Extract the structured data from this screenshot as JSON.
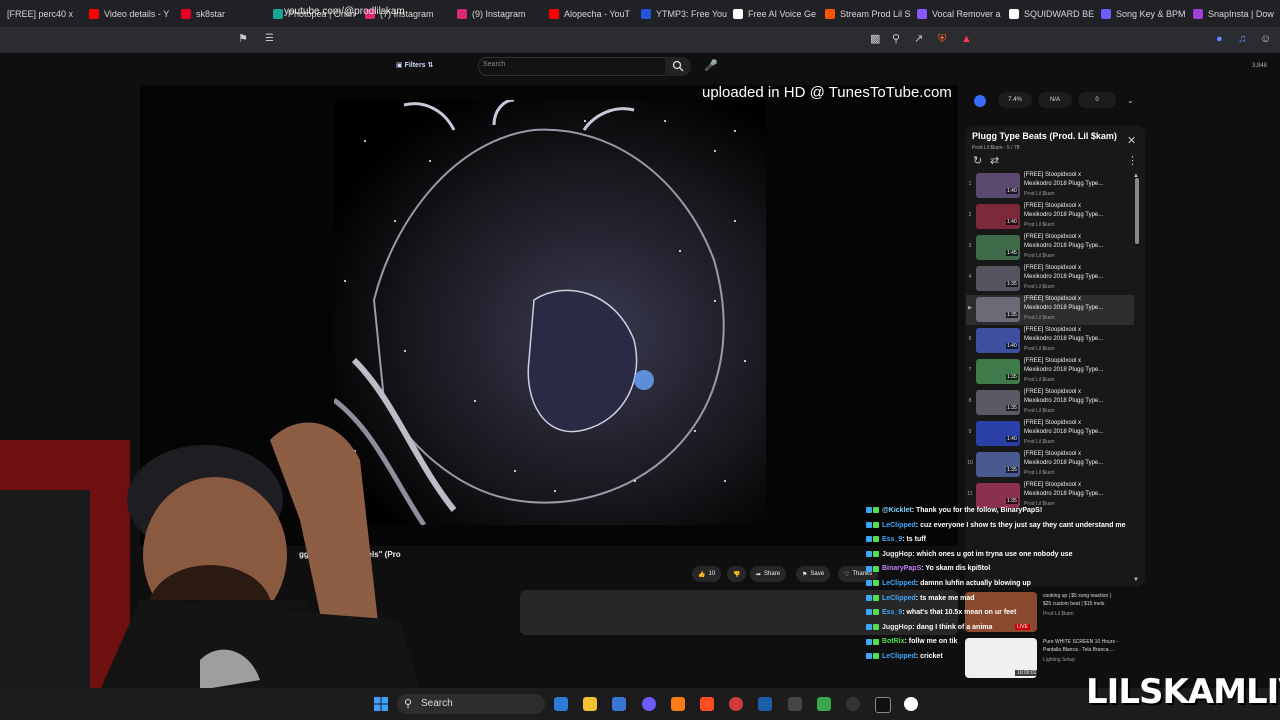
{
  "browser": {
    "tabs": [
      {
        "label": "[FREE] perc40 x",
        "color": "#e1e1e1"
      },
      {
        "label": "Video details - Y",
        "color": "#ff0000"
      },
      {
        "label": "sk8star",
        "color": "#e60023"
      },
      {
        "label": "Photopea | Onlin",
        "color": "#18a497"
      },
      {
        "label": "(7) Instagram",
        "color": "#d62976"
      },
      {
        "label": "(9) Instagram",
        "color": "#d62976"
      },
      {
        "label": "Alopecha - YouT",
        "color": "#ff0000"
      },
      {
        "label": "YTMP3: Free You",
        "color": "#2255dd"
      },
      {
        "label": "Free AI Voice Ge",
        "color": "#ffffff"
      },
      {
        "label": "Stream Prod Lil S",
        "color": "#ff5500"
      },
      {
        "label": "Vocal Remover a",
        "color": "#8855ff"
      },
      {
        "label": "SQUIDWARD BE",
        "color": "#ffffff"
      },
      {
        "label": "Song Key & BPM",
        "color": "#6a5cff"
      },
      {
        "label": "SnapInsta | Dow",
        "color": "#a23ed8"
      }
    ],
    "address": "youtube.com/@prodlilskam"
  },
  "youtube": {
    "filters_label": "Filters",
    "search_placeholder": "Search",
    "counter": "3,848",
    "watermark": "uploaded in HD @ TunesToTube.com",
    "video_title": "gg Type Beat \"jewels\" (Pro",
    "actions": {
      "like_count": "10",
      "share_label": "Share",
      "save_label": "Save",
      "thanks_label": "Thanks"
    },
    "stats": [
      "7.4%",
      "N/A",
      "0"
    ],
    "playlist": {
      "title": "Plugg Type Beats (Prod. Lil $kam)",
      "subtitle": "Prod Lil $kam - 5 / 78",
      "items": [
        {
          "num": "1",
          "t1": "[FREE] Stoopidxool x",
          "t2": "Mexikodro 2018 Plugg Type...",
          "channel": "Prod Lil $kam",
          "dur": "1:40",
          "color": "#5a4a70"
        },
        {
          "num": "2",
          "t1": "[FREE] Stoopidxool x",
          "t2": "Mexikodro 2018 Plugg Type...",
          "channel": "Prod Lil $kam",
          "dur": "1:40",
          "color": "#7a2a3a"
        },
        {
          "num": "3",
          "t1": "[FREE] Stoopidxool x",
          "t2": "Mexikodro 2018 Plugg Type...",
          "channel": "Prod Lil $kam",
          "dur": "1:45",
          "color": "#3f6a4a"
        },
        {
          "num": "4",
          "t1": "[FREE] Stoopidxool x",
          "t2": "Mexikodro 2018 Plugg Type...",
          "channel": "Prod Lil $kam",
          "dur": "1:35",
          "color": "#555560"
        },
        {
          "num": "",
          "t1": "[FREE] Stoopidxool x",
          "t2": "Mexikodro 2018 Plugg Type...",
          "channel": "Prod Lil $kam",
          "dur": "1:35",
          "color": "#6b6b78",
          "active": true
        },
        {
          "num": "6",
          "t1": "[FREE] Stoopidxool x",
          "t2": "Mexikodro 2018 Plugg Type...",
          "channel": "Prod Lil $kam",
          "dur": "1:40",
          "color": "#3f4fa0"
        },
        {
          "num": "7",
          "t1": "[FREE] Stoopidxool x",
          "t2": "Mexikodro 2018 Plugg Type...",
          "channel": "Prod Lil $kam",
          "dur": "1:35",
          "color": "#3f7a4a"
        },
        {
          "num": "8",
          "t1": "[FREE] Stoopidxool x",
          "t2": "Mexikodro 2018 Plugg Type...",
          "channel": "Prod Lil $kam",
          "dur": "1:35",
          "color": "#5a5a64"
        },
        {
          "num": "9",
          "t1": "[FREE] Stoopidxool x",
          "t2": "Mexikodro 2018 Plugg Type...",
          "channel": "Prod Lil $kam",
          "dur": "1:40",
          "color": "#2a40a8"
        },
        {
          "num": "10",
          "t1": "[FREE] Stoopidxool x",
          "t2": "Mexikodro 2018 Plugg Type...",
          "channel": "Prod Lil $kam",
          "dur": "1:35",
          "color": "#4a5a90"
        },
        {
          "num": "11",
          "t1": "[FREE] Stoopidxool x",
          "t2": "Mexikodro 2018 Plugg Type...",
          "channel": "Prod Lil $kam",
          "dur": "1:35",
          "color": "#8a3050"
        }
      ]
    },
    "chat": [
      {
        "user": "@Kicklet",
        "text": ": Thank you for the follow, BinaryPapS!",
        "color": "#7fd6ff"
      },
      {
        "user": "LeClipped",
        "text": ": cuz everyone I show ts they just say they cant understand me",
        "color": "#3ea6ff"
      },
      {
        "user": "Ess_9",
        "text": ": ts tuff",
        "color": "#3ea6ff"
      },
      {
        "user": "JuggHop",
        "text": ": which ones u got im tryna use one nobody use",
        "color": "#e8e8e8"
      },
      {
        "user": "BinaryPapS",
        "text": ": Yo skam dis kpi5tol",
        "color": "#c080ff"
      },
      {
        "user": "LeClipped",
        "text": ": damnn luhfin actually blowing up",
        "color": "#3ea6ff"
      },
      {
        "user": "LeClipped",
        "text": ": ts make me mad",
        "color": "#3ea6ff"
      },
      {
        "user": "Ess_9",
        "text": ": what's that 10.5x mean on ur feet",
        "color": "#3ea6ff"
      },
      {
        "user": "JuggHop",
        "text": ": dang I think of a anima",
        "color": "#e8e8e8"
      },
      {
        "user": "BotRix",
        "text": ": follw me on tik",
        "color": "#4fe04f"
      },
      {
        "user": "LeClipped",
        "text": ": cricket",
        "color": "#3ea6ff"
      }
    ],
    "recommended": [
      {
        "t1": "cooking up | $5 song reaction |",
        "t2": "$25 custom beat | $15 mels",
        "t3": "Prod Lil $kam",
        "badge": "LIVE",
        "color": "#8a4a30"
      },
      {
        "t1": "Pure WHITE SCREEN 10 Hours -",
        "t2": "Pantalla Blanca - Tela Branca ...",
        "t3": "Lighting Setup",
        "badge": "10:00:01",
        "color": "#f0f0f0"
      }
    ]
  },
  "taskbar": {
    "search_label": "Search"
  },
  "brand": "LILSKAMLIVE"
}
